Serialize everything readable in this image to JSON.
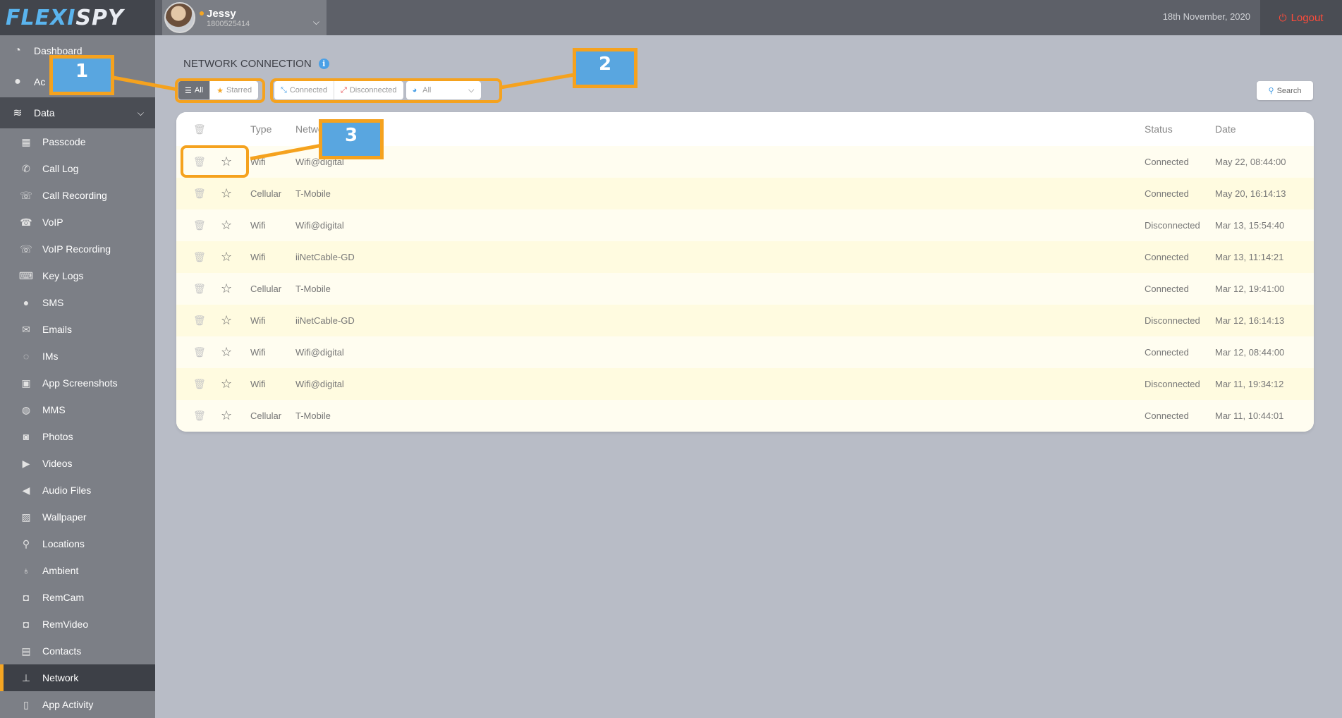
{
  "app": {
    "logo_part1": "FLEXI",
    "logo_part2": "SPY"
  },
  "header": {
    "device_name": "Jessy",
    "device_number": "1800525414",
    "date": "18th November, 2020",
    "logout_label": "Logout"
  },
  "sidebar": {
    "top_items": [
      {
        "label": "Dashboard",
        "icon": "dashboard-icon"
      },
      {
        "label": "Ac",
        "icon": "user-icon"
      },
      {
        "label": "Data",
        "icon": "database-icon"
      }
    ],
    "items": [
      {
        "label": "Passcode",
        "icon": "grid-icon"
      },
      {
        "label": "Call Log",
        "icon": "phone-icon"
      },
      {
        "label": "Call Recording",
        "icon": "phone-wave-icon"
      },
      {
        "label": "VoIP",
        "icon": "voip-icon"
      },
      {
        "label": "VoIP Recording",
        "icon": "voip-recording-icon"
      },
      {
        "label": "Key Logs",
        "icon": "keyboard-icon"
      },
      {
        "label": "SMS",
        "icon": "chat-bubble-icon"
      },
      {
        "label": "Emails",
        "icon": "envelope-icon"
      },
      {
        "label": "IMs",
        "icon": "im-bubbles-icon"
      },
      {
        "label": "App Screenshots",
        "icon": "screenshot-icon"
      },
      {
        "label": "MMS",
        "icon": "mms-icon"
      },
      {
        "label": "Photos",
        "icon": "camera-icon"
      },
      {
        "label": "Videos",
        "icon": "video-camera-icon"
      },
      {
        "label": "Audio Files",
        "icon": "speaker-icon"
      },
      {
        "label": "Wallpaper",
        "icon": "image-icon"
      },
      {
        "label": "Locations",
        "icon": "map-pin-icon"
      },
      {
        "label": "Ambient",
        "icon": "microphone-icon"
      },
      {
        "label": "RemCam",
        "icon": "remcam-icon"
      },
      {
        "label": "RemVideo",
        "icon": "remvideo-icon"
      },
      {
        "label": "Contacts",
        "icon": "address-book-icon"
      },
      {
        "label": "Network",
        "icon": "sitemap-icon",
        "active": true
      },
      {
        "label": "App Activity",
        "icon": "mobile-icon"
      }
    ]
  },
  "page": {
    "title": "NETWORK CONNECTION"
  },
  "filters": {
    "all_label": "All",
    "starred_label": "Starred",
    "connected_label": "Connected",
    "disconnected_label": "Disconnected",
    "select_value": "All",
    "search_label": "Search"
  },
  "table": {
    "columns": {
      "type": "Type",
      "network": "Networ",
      "status": "Status",
      "date": "Date"
    },
    "rows": [
      {
        "type": "Wifi",
        "network": "Wifi@digital",
        "status": "Connected",
        "date": "May 22, 08:44:00"
      },
      {
        "type": "Cellular",
        "network": "T-Mobile",
        "status": "Connected",
        "date": "May 20, 16:14:13"
      },
      {
        "type": "Wifi",
        "network": "Wifi@digital",
        "status": "Disconnected",
        "date": "Mar 13, 15:54:40"
      },
      {
        "type": "Wifi",
        "network": "iiNetCable-GD",
        "status": "Connected",
        "date": "Mar 13, 11:14:21"
      },
      {
        "type": "Cellular",
        "network": "T-Mobile",
        "status": "Connected",
        "date": "Mar 12, 19:41:00"
      },
      {
        "type": "Wifi",
        "network": "iiNetCable-GD",
        "status": "Disconnected",
        "date": "Mar 12, 16:14:13"
      },
      {
        "type": "Wifi",
        "network": "Wifi@digital",
        "status": "Connected",
        "date": "Mar 12, 08:44:00"
      },
      {
        "type": "Wifi",
        "network": "Wifi@digital",
        "status": "Disconnected",
        "date": "Mar 11, 19:34:12"
      },
      {
        "type": "Cellular",
        "network": "T-Mobile",
        "status": "Connected",
        "date": "Mar 11, 10:44:01"
      }
    ]
  },
  "annotations": {
    "one": "1",
    "two": "2",
    "three": "3",
    "color": "#f5a21e"
  },
  "colors": {
    "accent": "#f5a623",
    "logout": "#ff4b3a",
    "info": "#4aa0e6",
    "connected_icon": "#4aa0e6",
    "disconnected_icon": "#e5484d"
  }
}
